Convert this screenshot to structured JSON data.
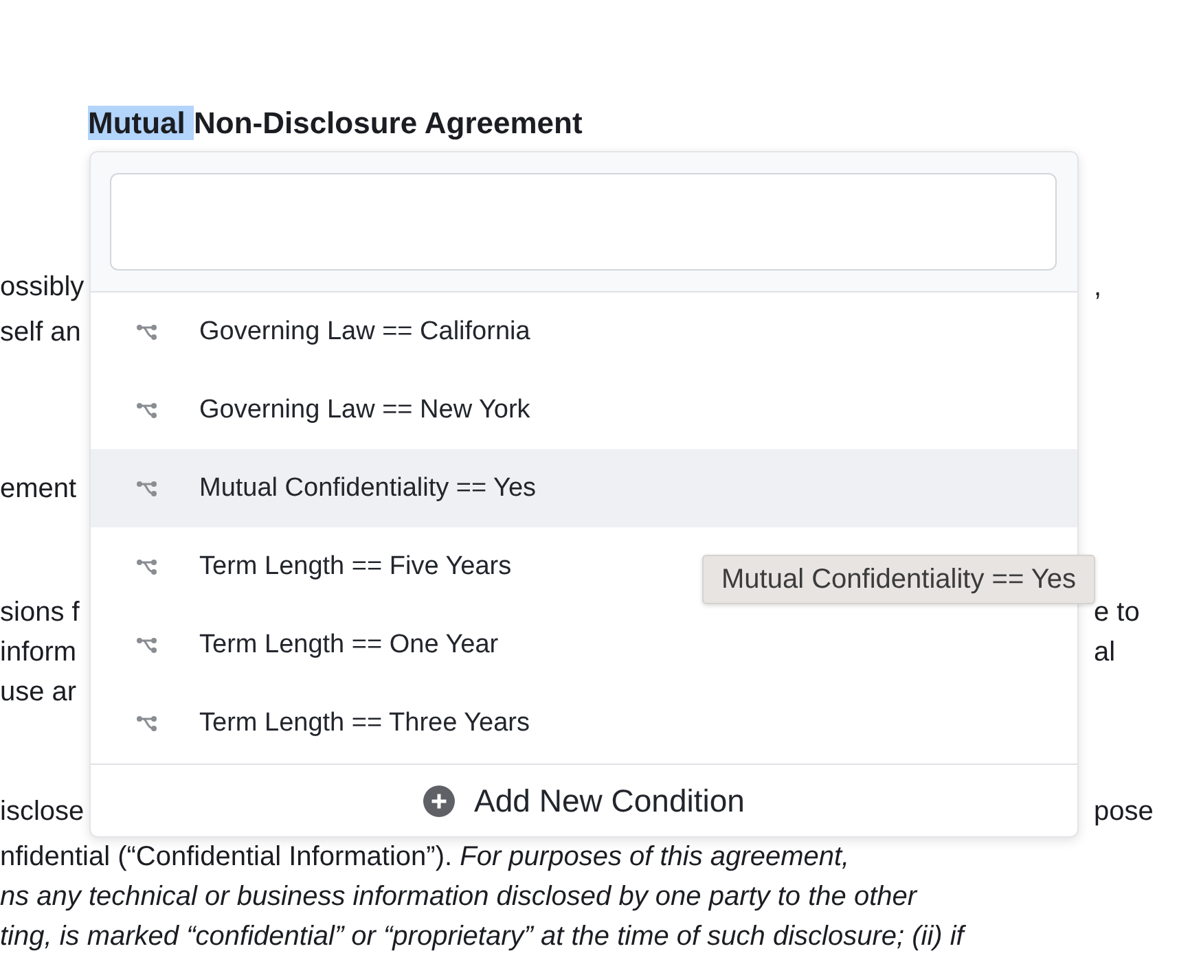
{
  "document": {
    "title": {
      "highlighted": "Mutual ",
      "rest": "Non-Disclosure Agreement"
    },
    "paragraphs": [
      {
        "lines": [
          {
            "left": "ossibly",
            "right": ","
          },
          {
            "left": "self an"
          }
        ]
      },
      {
        "lines": [
          {
            "left": "ement"
          }
        ]
      },
      {
        "lines": [
          {
            "left": "sions f",
            "right": "e to"
          },
          {
            "left": "inform",
            "right": "al"
          },
          {
            "left": "use ar"
          }
        ]
      },
      {
        "lines": [
          {
            "left": "isclose",
            "right": "pose"
          },
          {
            "left": "nfidential (“Confidential Information”). *For purposes of this agreement,*"
          },
          {
            "left": "*ns any technical or business information disclosed by one party to the other*"
          },
          {
            "left": "*ting, is marked “confidential” or “proprietary” at the time of such disclosure; (ii) if*"
          }
        ]
      }
    ]
  },
  "condition_menu": {
    "items": [
      {
        "label": "Governing Law == California",
        "selected": false
      },
      {
        "label": "Governing Law == New York",
        "selected": false
      },
      {
        "label": "Mutual Confidentiality == Yes",
        "selected": true
      },
      {
        "label": "Term Length == Five Years",
        "selected": false
      },
      {
        "label": "Term Length == One Year",
        "selected": false
      },
      {
        "label": "Term Length == Three Years",
        "selected": false
      }
    ],
    "add_button": {
      "label": "Add New Condition"
    }
  },
  "tooltip": {
    "text": "Mutual Confidentiality == Yes"
  }
}
